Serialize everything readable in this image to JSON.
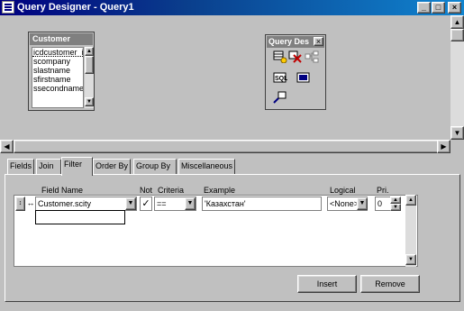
{
  "window": {
    "title": "Query Designer - Query1",
    "minimize_label": "_",
    "maximize_label": "□",
    "close_label": "×"
  },
  "table_window": {
    "title": "Customer",
    "fields": [
      "icdcustomer_i",
      "scompany",
      "slastname",
      "sfirstname",
      "ssecondname"
    ]
  },
  "query_toolbar": {
    "title": "Query Des",
    "close_label": "×"
  },
  "tabs": [
    "Fields",
    "Join",
    "Filter",
    "Order By",
    "Group By",
    "Miscellaneous"
  ],
  "active_tab": "Filter",
  "filter": {
    "headers": {
      "field_name": "Field Name",
      "not": "Not",
      "criteria": "Criteria",
      "example": "Example",
      "logical": "Logical",
      "pri": "Pri."
    },
    "row": {
      "field_name": "Customer.scity",
      "not_checked": "✓",
      "criteria": "==",
      "example": "'Казахстан'",
      "logical": "<None>",
      "pri": "0"
    }
  },
  "buttons": {
    "insert": "Insert",
    "remove": "Remove"
  }
}
